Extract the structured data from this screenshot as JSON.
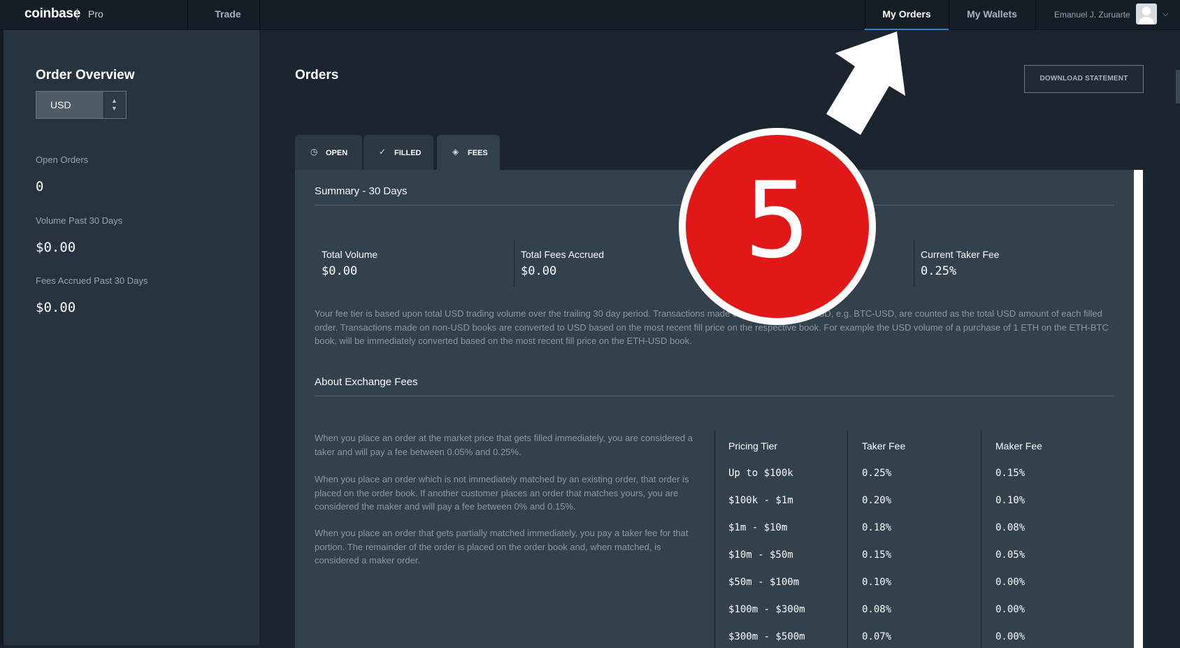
{
  "header": {
    "logo": "coinbase",
    "logo_sub": "Pro",
    "trade_label": "Trade",
    "my_orders_label": "My Orders",
    "my_wallets_label": "My Wallets",
    "user_name": "Emanuel J. Zuruarte"
  },
  "sidebar": {
    "title": "Order Overview",
    "currency": "USD",
    "open_orders_label": "Open Orders",
    "open_orders_value": "0",
    "volume_label": "Volume Past 30 Days",
    "volume_value": "$0.00",
    "fees_label": "Fees Accrued Past 30 Days",
    "fees_value": "$0.00"
  },
  "main": {
    "title": "Orders",
    "download_label": "DOWNLOAD STATEMENT",
    "tabs": [
      {
        "label": "OPEN",
        "icon": "clock-icon"
      },
      {
        "label": "FILLED",
        "icon": "check-circle-icon"
      },
      {
        "label": "FEES",
        "icon": "tag-icon"
      }
    ],
    "summary_title": "Summary - 30 Days",
    "stats": [
      {
        "label": "Total Volume",
        "value": "$0.00"
      },
      {
        "label": "Total Fees Accrued",
        "value": "$0.00"
      },
      {
        "label": "Current Taker Fee",
        "value": "0.25%"
      }
    ],
    "tier_paragraph": "Your fee tier is based upon total USD trading volume over the trailing 30 day period. Transactions made on books quoted in USD, e.g. BTC-USD, are counted as the total USD amount of each filled order. Transactions made on non-USD books are converted to USD based on the most recent fill price on the respective book. For example the USD volume of a purchase of 1 ETH on the ETH-BTC book, will be immediately converted based on the most recent fill price on the ETH-USD book.",
    "about_title": "About Exchange Fees",
    "about_paragraphs": [
      "When you place an order at the market price that gets filled immediately, you are considered a taker and will pay a fee between 0.05% and 0.25%.",
      "When you place an order which is not immediately matched by an existing order, that order is placed on the order book. If another customer places an order that matches yours, you are considered the maker and will pay a fee between 0% and 0.15%.",
      "When you place an order that gets partially matched immediately, you pay a taker fee for that portion. The remainder of the order is placed on the order book and, when matched, is considered a maker order."
    ],
    "fee_table": {
      "headers": [
        "Pricing Tier",
        "Taker Fee",
        "Maker Fee"
      ],
      "rows": [
        [
          "Up to $100k",
          "0.25%",
          "0.15%"
        ],
        [
          "$100k - $1m",
          "0.20%",
          "0.10%"
        ],
        [
          "$1m - $10m",
          "0.18%",
          "0.08%"
        ],
        [
          "$10m - $50m",
          "0.15%",
          "0.05%"
        ],
        [
          "$50m - $100m",
          "0.10%",
          "0.00%"
        ],
        [
          "$100m - $300m",
          "0.08%",
          "0.00%"
        ],
        [
          "$300m - $500m",
          "0.07%",
          "0.00%"
        ]
      ]
    }
  },
  "overlay": {
    "step_number": "5",
    "badge_color": "#e21717"
  }
}
